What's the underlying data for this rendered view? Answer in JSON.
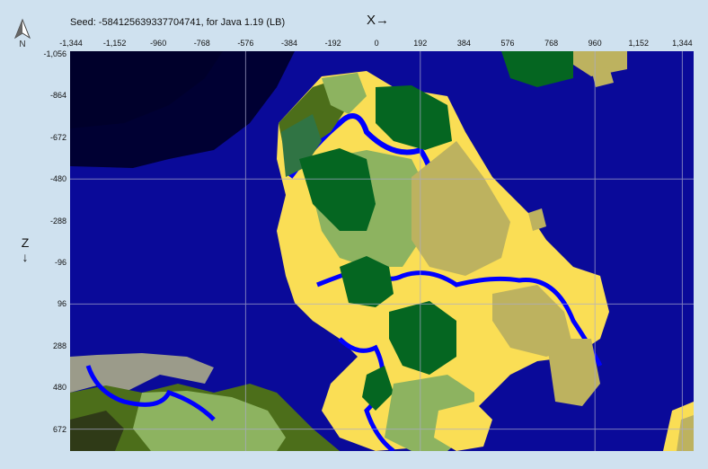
{
  "header": {
    "seed_info": "Seed: -584125639337704741, for Java 1.19 (LB)",
    "x_label": "X→",
    "z_label": "Z",
    "z_arrow": "↓",
    "north_label": "N"
  },
  "axes": {
    "x_ticks": [
      "-1,344",
      "-1,152",
      "-960",
      "-768",
      "-576",
      "-384",
      "-192",
      "0",
      "192",
      "384",
      "576",
      "768",
      "960",
      "1,152",
      "1,344"
    ],
    "z_ticks": [
      "-1,056",
      "-864",
      "-672",
      "-480",
      "-288",
      "-96",
      "96",
      "288",
      "480",
      "672"
    ]
  },
  "map": {
    "colors": {
      "deep_ocean": "#000033",
      "darker_ocean": "#00002b",
      "ocean": "#0a0a99",
      "river": "#0000ff",
      "beach": "#fade55",
      "forest": "#056621",
      "birch_forest": "#307444",
      "plains": "#8db360",
      "savanna": "#bdb25f",
      "swamp": "#4c6e1a",
      "mountains": "#9b9b8a",
      "grid": "#aaaacc"
    }
  }
}
